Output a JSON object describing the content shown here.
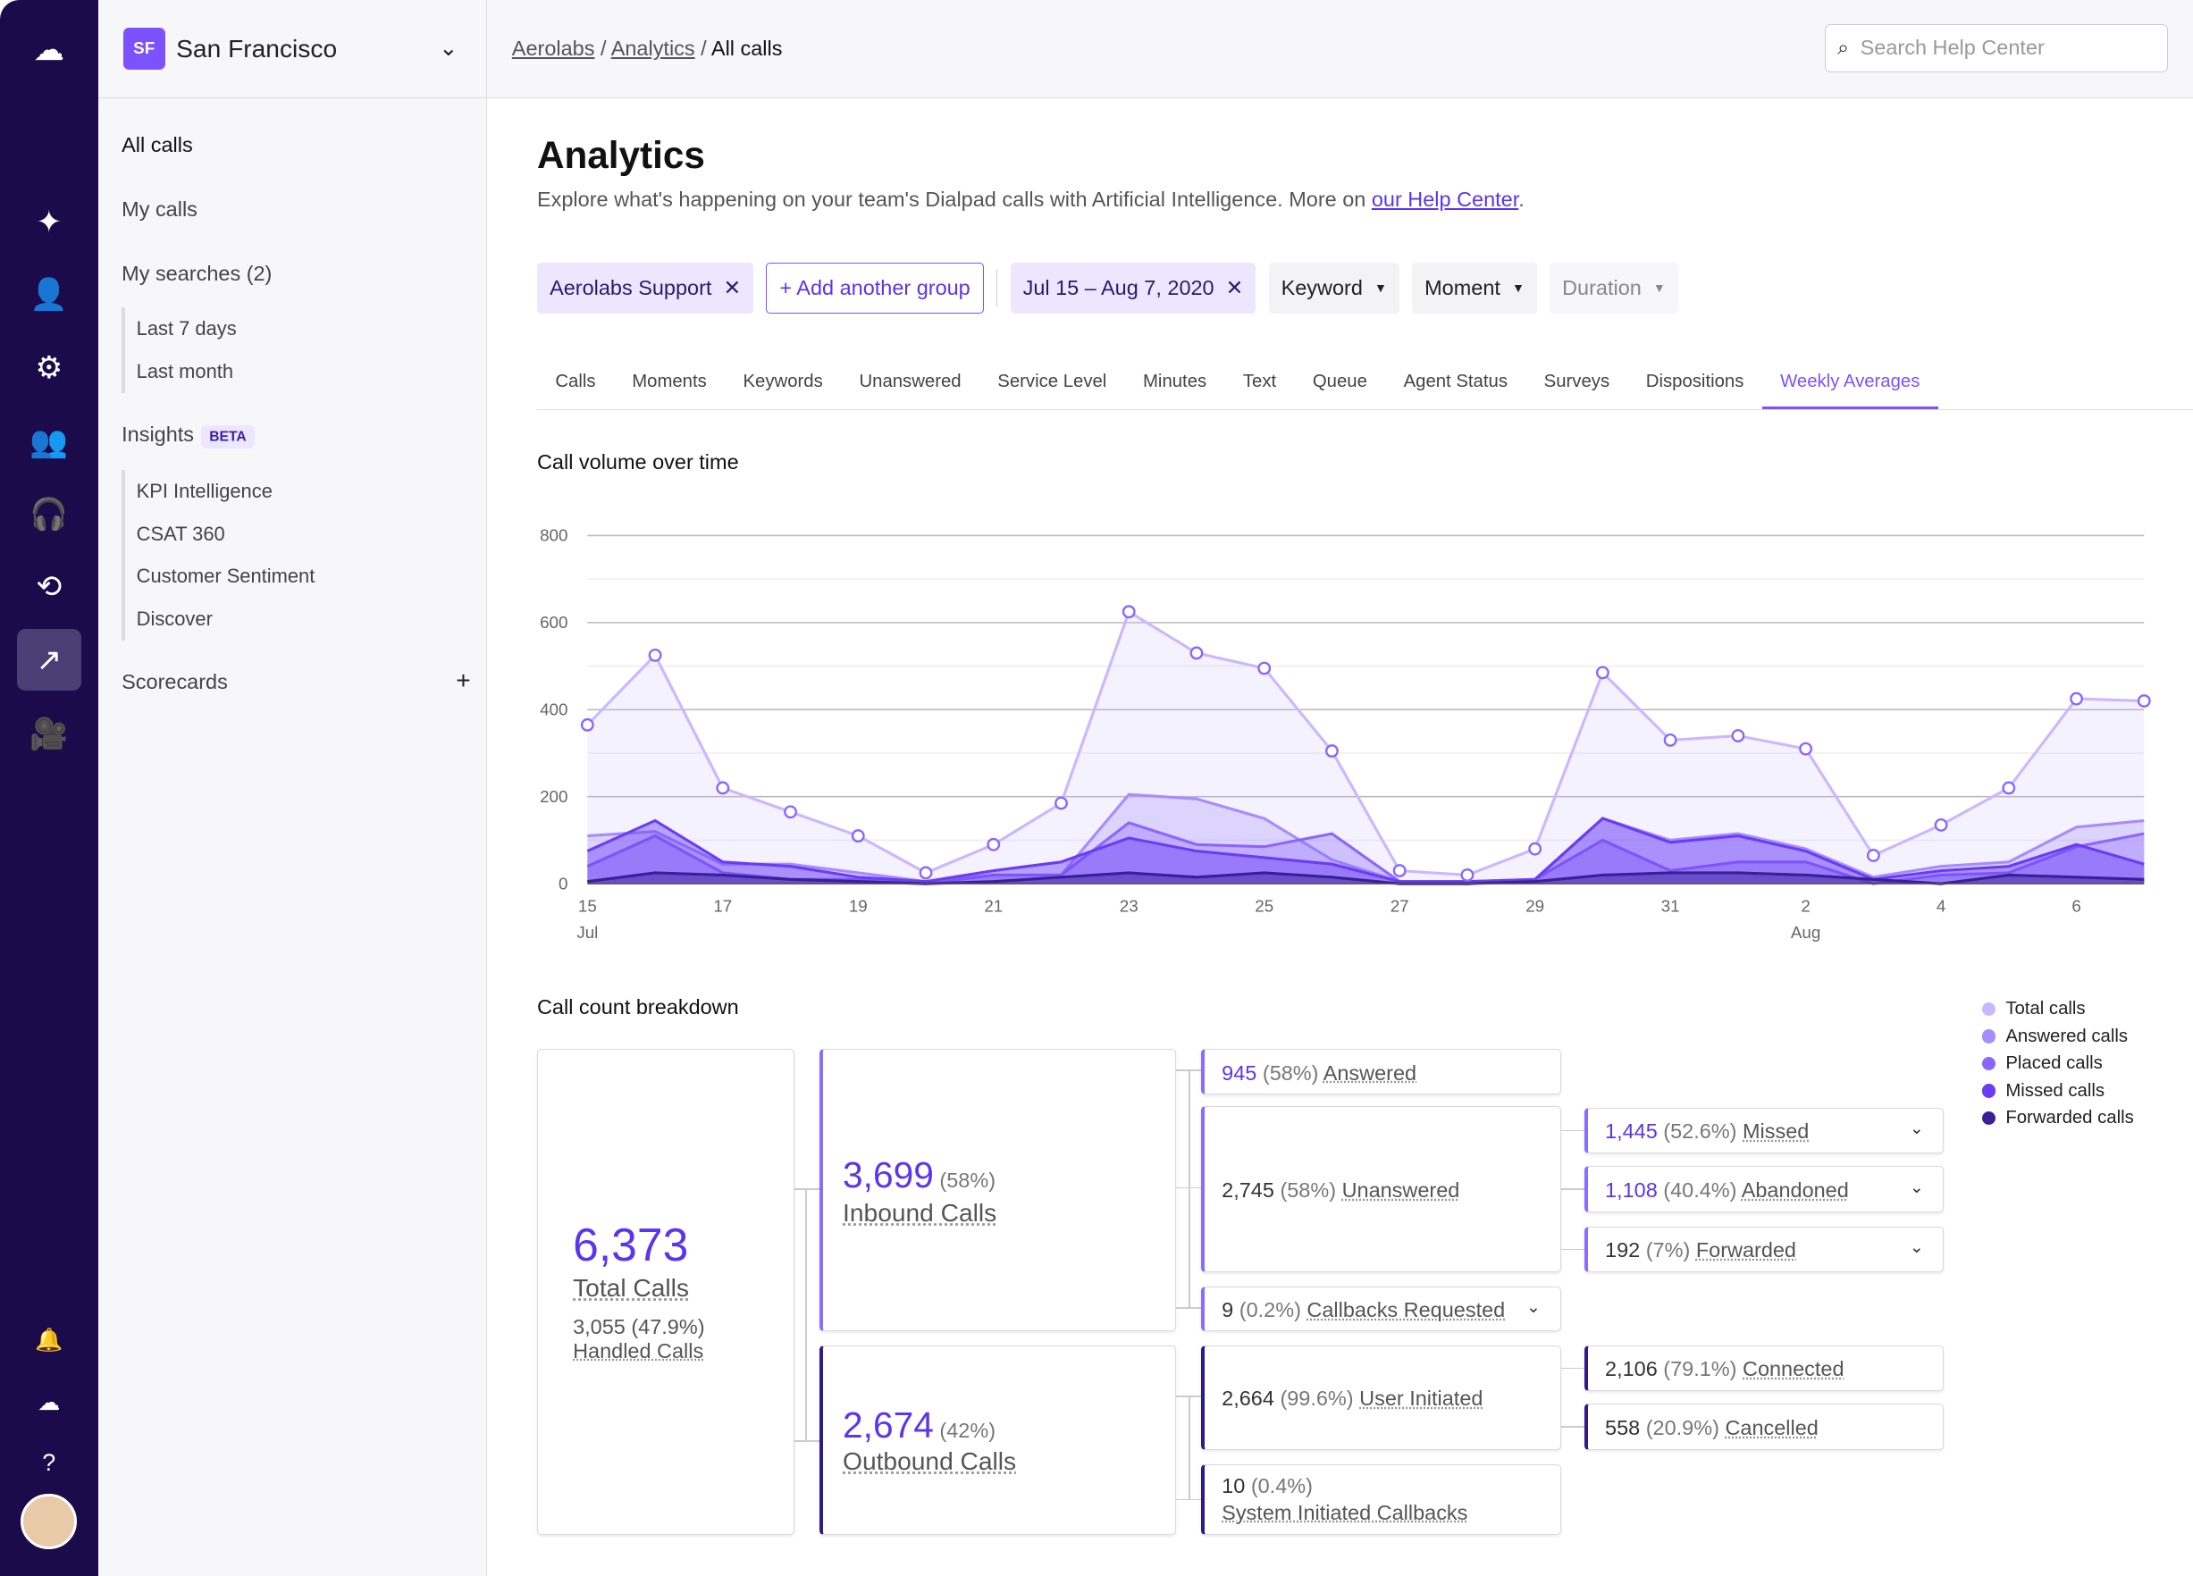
{
  "rail": {
    "icons": [
      "dialpad-logo-icon",
      "sparkles-icon",
      "person-icon",
      "gear-icon",
      "team-icon",
      "headset-icon",
      "history-icon",
      "analytics-trend-icon",
      "video-icon",
      "bell-icon",
      "dialpad-small-icon",
      "help-icon",
      "avatar"
    ]
  },
  "sidebar": {
    "org_badge": "SF",
    "org_name": "San Francisco",
    "all_calls": "All calls",
    "my_calls": "My calls",
    "my_searches": "My searches (2)",
    "searches": [
      "Last 7 days",
      "Last month"
    ],
    "insights": "Insights",
    "beta": "BETA",
    "insight_items": [
      "KPI Intelligence",
      "CSAT 360",
      "Customer Sentiment",
      "Discover"
    ],
    "scorecards": "Scorecards",
    "add": "+"
  },
  "topbar": {
    "breadcrumb": [
      "Aerolabs",
      "Analytics",
      "All calls"
    ],
    "search_placeholder": "Search Help Center"
  },
  "page": {
    "title": "Analytics",
    "description": "Explore what's happening on your team's Dialpad calls with Artificial Intelligence. More on ",
    "help_link": "our Help Center",
    "period": "."
  },
  "filters": {
    "group": "Aerolabs Support",
    "add_group": "+ Add another group",
    "date": "Jul 15 – Aug 7, 2020",
    "keyword": "Keyword",
    "moment": "Moment",
    "duration": "Duration"
  },
  "tabs": [
    "Calls",
    "Moments",
    "Keywords",
    "Unanswered",
    "Service Level",
    "Minutes",
    "Text",
    "Queue",
    "Agent Status",
    "Surveys",
    "Dispositions",
    "Weekly Averages"
  ],
  "active_tab": "Weekly Averages",
  "chart_data": {
    "type": "area",
    "title": "Call volume over time",
    "x": [
      "Jul 15",
      "Jul 16",
      "Jul 17",
      "Jul 18",
      "Jul 19",
      "Jul 20",
      "Jul 21",
      "Jul 22",
      "Jul 23",
      "Jul 24",
      "Jul 25",
      "Jul 26",
      "Jul 27",
      "Jul 28",
      "Jul 29",
      "Jul 30",
      "Jul 31",
      "Aug 1",
      "Aug 2",
      "Aug 3",
      "Aug 4",
      "Aug 5",
      "Aug 6",
      "Aug 7"
    ],
    "x_tick_labels": [
      {
        "i": 0,
        "day": "15",
        "month": "Jul"
      },
      {
        "i": 2,
        "day": "17"
      },
      {
        "i": 4,
        "day": "19"
      },
      {
        "i": 6,
        "day": "21"
      },
      {
        "i": 8,
        "day": "23"
      },
      {
        "i": 10,
        "day": "25"
      },
      {
        "i": 12,
        "day": "27"
      },
      {
        "i": 14,
        "day": "29"
      },
      {
        "i": 16,
        "day": "31"
      },
      {
        "i": 18,
        "day": "2",
        "month": "Aug"
      },
      {
        "i": 20,
        "day": "4"
      },
      {
        "i": 22,
        "day": "6"
      }
    ],
    "yticks": [
      0,
      200,
      400,
      600,
      800
    ],
    "ylim": [
      0,
      800
    ],
    "grid": true,
    "legend": "right",
    "series": [
      {
        "name": "Total calls",
        "color": "#c9b8ff",
        "values": [
          365,
          525,
          220,
          165,
          110,
          25,
          90,
          185,
          625,
          530,
          495,
          305,
          30,
          20,
          80,
          485,
          330,
          340,
          310,
          65,
          135,
          220,
          425,
          420
        ]
      },
      {
        "name": "Answered calls",
        "color": "#a58cff",
        "values": [
          110,
          120,
          45,
          45,
          25,
          5,
          20,
          20,
          205,
          195,
          150,
          55,
          5,
          5,
          10,
          150,
          100,
          115,
          80,
          15,
          40,
          50,
          130,
          145
        ]
      },
      {
        "name": "Placed calls",
        "color": "#8a66ff",
        "values": [
          40,
          110,
          25,
          10,
          10,
          0,
          20,
          20,
          140,
          90,
          85,
          115,
          5,
          0,
          10,
          100,
          30,
          50,
          50,
          0,
          20,
          25,
          85,
          115
        ]
      },
      {
        "name": "Missed calls",
        "color": "#6a3df5",
        "values": [
          75,
          145,
          50,
          40,
          15,
          5,
          30,
          50,
          105,
          75,
          60,
          45,
          5,
          5,
          10,
          150,
          95,
          110,
          75,
          10,
          30,
          40,
          90,
          45
        ]
      },
      {
        "name": "Forwarded calls",
        "color": "#3b1f99",
        "values": [
          5,
          25,
          20,
          10,
          5,
          0,
          5,
          15,
          25,
          15,
          25,
          15,
          0,
          0,
          5,
          20,
          25,
          25,
          20,
          10,
          0,
          20,
          15,
          10
        ]
      }
    ]
  },
  "breakdown": {
    "title": "Call count breakdown",
    "total": {
      "value": "6,373",
      "label": "Total Calls",
      "handled_value": "3,055 (47.9%)",
      "handled_label": "Handled Calls"
    },
    "inbound": {
      "value": "3,699",
      "pct": "(58%)",
      "label": "Inbound Calls"
    },
    "outbound": {
      "value": "2,674",
      "pct": "(42%)",
      "label": "Outbound Calls"
    },
    "answered": {
      "value": "945",
      "pct": "(58%)",
      "label": "Answered"
    },
    "unanswered": {
      "value": "2,745",
      "pct": "(58%)",
      "label": "Unanswered"
    },
    "callbacks": {
      "value": "9",
      "pct": "(0.2%)",
      "label": "Callbacks Requested"
    },
    "missed": {
      "value": "1,445",
      "pct": "(52.6%)",
      "label": "Missed"
    },
    "abandoned": {
      "value": "1,108",
      "pct": "(40.4%)",
      "label": "Abandoned"
    },
    "forwarded": {
      "value": "192",
      "pct": "(7%)",
      "label": "Forwarded"
    },
    "user_initiated": {
      "value": "2,664",
      "pct": "(99.6%)",
      "label": "User Initiated"
    },
    "system_callbacks": {
      "value": "10",
      "pct": "(0.4%)",
      "label": "System Initiated Callbacks"
    },
    "connected": {
      "value": "2,106",
      "pct": "(79.1%)",
      "label": "Connected"
    },
    "cancelled": {
      "value": "558",
      "pct": "(20.9%)",
      "label": "Cancelled"
    }
  }
}
